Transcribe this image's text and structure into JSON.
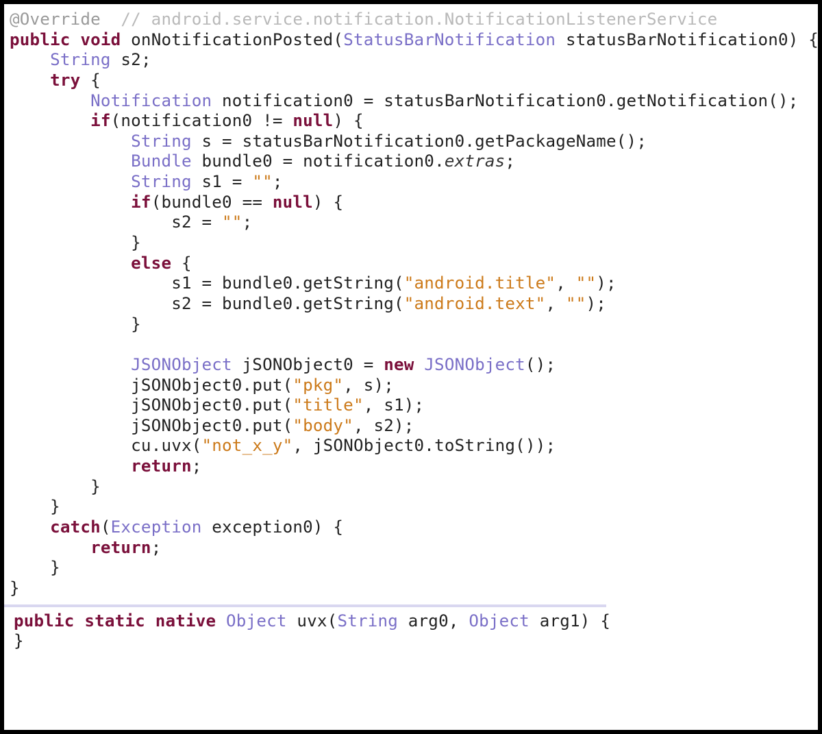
{
  "code": {
    "annotation": "@Override",
    "comment": "// android.service.notification.NotificationListenerService",
    "kw_public": "public",
    "kw_void": "void",
    "kw_static": "static",
    "kw_native": "native",
    "kw_try": "try",
    "kw_if": "if",
    "kw_else": "else",
    "kw_new": "new",
    "kw_return": "return",
    "kw_catch": "catch",
    "kw_null": "null",
    "t_String": "String",
    "t_StatusBarNotification": "StatusBarNotification",
    "t_Notification": "Notification",
    "t_Bundle": "Bundle",
    "t_JSONObject": "JSONObject",
    "t_Exception": "Exception",
    "t_Object": "Object",
    "m_onNotificationPosted": "onNotificationPosted",
    "m_getNotification": "getNotification",
    "m_getPackageName": "getPackageName",
    "m_getString": "getString",
    "m_put": "put",
    "m_toString": "toString",
    "m_uvx": "uvx",
    "f_extras": "extras",
    "v_statusBarNotification0": "statusBarNotification0",
    "v_notification0": "notification0",
    "v_bundle0": "bundle0",
    "v_s": "s",
    "v_s1": "s1",
    "v_s2": "s2",
    "v_jSONObject0": "jSONObject0",
    "v_exception0": "exception0",
    "v_cu": "cu",
    "v_arg0": "arg0",
    "v_arg1": "arg1",
    "str_empty": "\"\"",
    "str_android_title": "\"android.title\"",
    "str_android_text": "\"android.text\"",
    "str_pkg": "\"pkg\"",
    "str_title": "\"title\"",
    "str_body": "\"body\"",
    "str_not_x_y": "\"not_x_y\"",
    "sp": " ",
    "sp2": "  ",
    "ind1": "    ",
    "ind2": "        ",
    "ind3": "            ",
    "ind4": "                ",
    "lparen": "(",
    "rparen": ")",
    "lbrace": "{",
    "rbrace": "}",
    "semi": ";",
    "comma": ",",
    "dot": ".",
    "eq": "=",
    "neq": "!=",
    "eqeq": "=="
  }
}
